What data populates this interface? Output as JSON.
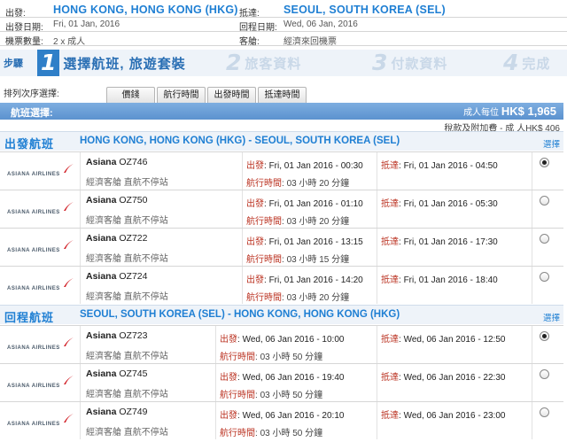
{
  "trip": {
    "origin_label": "出發:",
    "origin": "HONG KONG, HONG KONG (HKG)",
    "dest_label": "抵達:",
    "dest": "SEOUL, SOUTH KOREA (SEL)",
    "depart_date_label": "出發日期:",
    "depart_date": "Fri, 01 Jan, 2016",
    "return_date_label": "回程日期:",
    "return_date": "Wed, 06 Jan, 2016",
    "tickets_label": "機票數量:",
    "tickets": "2 x 成人",
    "cabin_label": "客艙:",
    "cabin": "經濟來回機票"
  },
  "steps": [
    {
      "label": "步驟",
      "num": "",
      "text": ""
    },
    {
      "num": "1",
      "text": "選擇航班, 旅遊套裝"
    },
    {
      "num": "2",
      "text": "旅客資料"
    },
    {
      "num": "3",
      "text": "付款資料"
    },
    {
      "num": "4",
      "text": "完成"
    }
  ],
  "sort": {
    "label": "排列次序選擇:",
    "tabs": [
      "價錢",
      "航行時間",
      "出發時間",
      "抵達時間"
    ]
  },
  "header": {
    "title": "航班選擇:",
    "price_label": "成人每位",
    "price": "HK$ 1,965",
    "tax_line": "稅款及附加費 - 成 人HK$ 406"
  },
  "outbound": {
    "title": "出發航班",
    "route": "HONG KONG, HONG KONG (HKG) - SEOUL, SOUTH KOREA (SEL)",
    "select_label": "選擇",
    "flights": [
      {
        "airline": "Asiana",
        "code": "OZ746",
        "class": "經濟客艙 直航不停站",
        "dep": "Fri, 01 Jan 2016 - 00:30",
        "arr": "Fri, 01 Jan 2016 - 04:50",
        "dur": "03 小時 20 分鐘",
        "selected": true
      },
      {
        "airline": "Asiana",
        "code": "OZ750",
        "class": "經濟客艙 直航不停站",
        "dep": "Fri, 01 Jan 2016 - 01:10",
        "arr": "Fri, 01 Jan 2016 - 05:30",
        "dur": "03 小時 20 分鐘",
        "selected": false
      },
      {
        "airline": "Asiana",
        "code": "OZ722",
        "class": "經濟客艙 直航不停站",
        "dep": "Fri, 01 Jan 2016 - 13:15",
        "arr": "Fri, 01 Jan 2016 - 17:30",
        "dur": "03 小時 15 分鐘",
        "selected": false
      },
      {
        "airline": "Asiana",
        "code": "OZ724",
        "class": "經濟客艙 直航不停站",
        "dep": "Fri, 01 Jan 2016 - 14:20",
        "arr": "Fri, 01 Jan 2016 - 18:40",
        "dur": "03 小時 20 分鐘",
        "selected": false
      }
    ]
  },
  "inbound": {
    "title": "回程航班",
    "route": "SEOUL, SOUTH KOREA (SEL) - HONG KONG, HONG KONG (HKG)",
    "select_label": "選擇",
    "flights": [
      {
        "airline": "Asiana",
        "code": "OZ723",
        "class": "經濟客艙 直航不停站",
        "dep": "Wed, 06 Jan 2016 - 10:00",
        "arr": "Wed, 06 Jan 2016 - 12:50",
        "dur": "03 小時 50 分鐘",
        "selected": true
      },
      {
        "airline": "Asiana",
        "code": "OZ745",
        "class": "經濟客艙 直航不停站",
        "dep": "Wed, 06 Jan 2016 - 19:40",
        "arr": "Wed, 06 Jan 2016 - 22:30",
        "dur": "03 小時 50 分鐘",
        "selected": false
      },
      {
        "airline": "Asiana",
        "code": "OZ749",
        "class": "經濟客艙 直航不停站",
        "dep": "Wed, 06 Jan 2016 - 20:10",
        "arr": "Wed, 06 Jan 2016 - 23:00",
        "dur": "03 小時 50 分鐘",
        "selected": false
      }
    ]
  },
  "labels": {
    "dep": "出發",
    "arr": "抵達",
    "dur": "航行時間",
    "airline_logo_text": "ASIANA AIRLINES"
  },
  "colors": {
    "accent_blue": "#1f7fd3",
    "header_bar": "#5b92cf",
    "label_red": "#b32"
  }
}
